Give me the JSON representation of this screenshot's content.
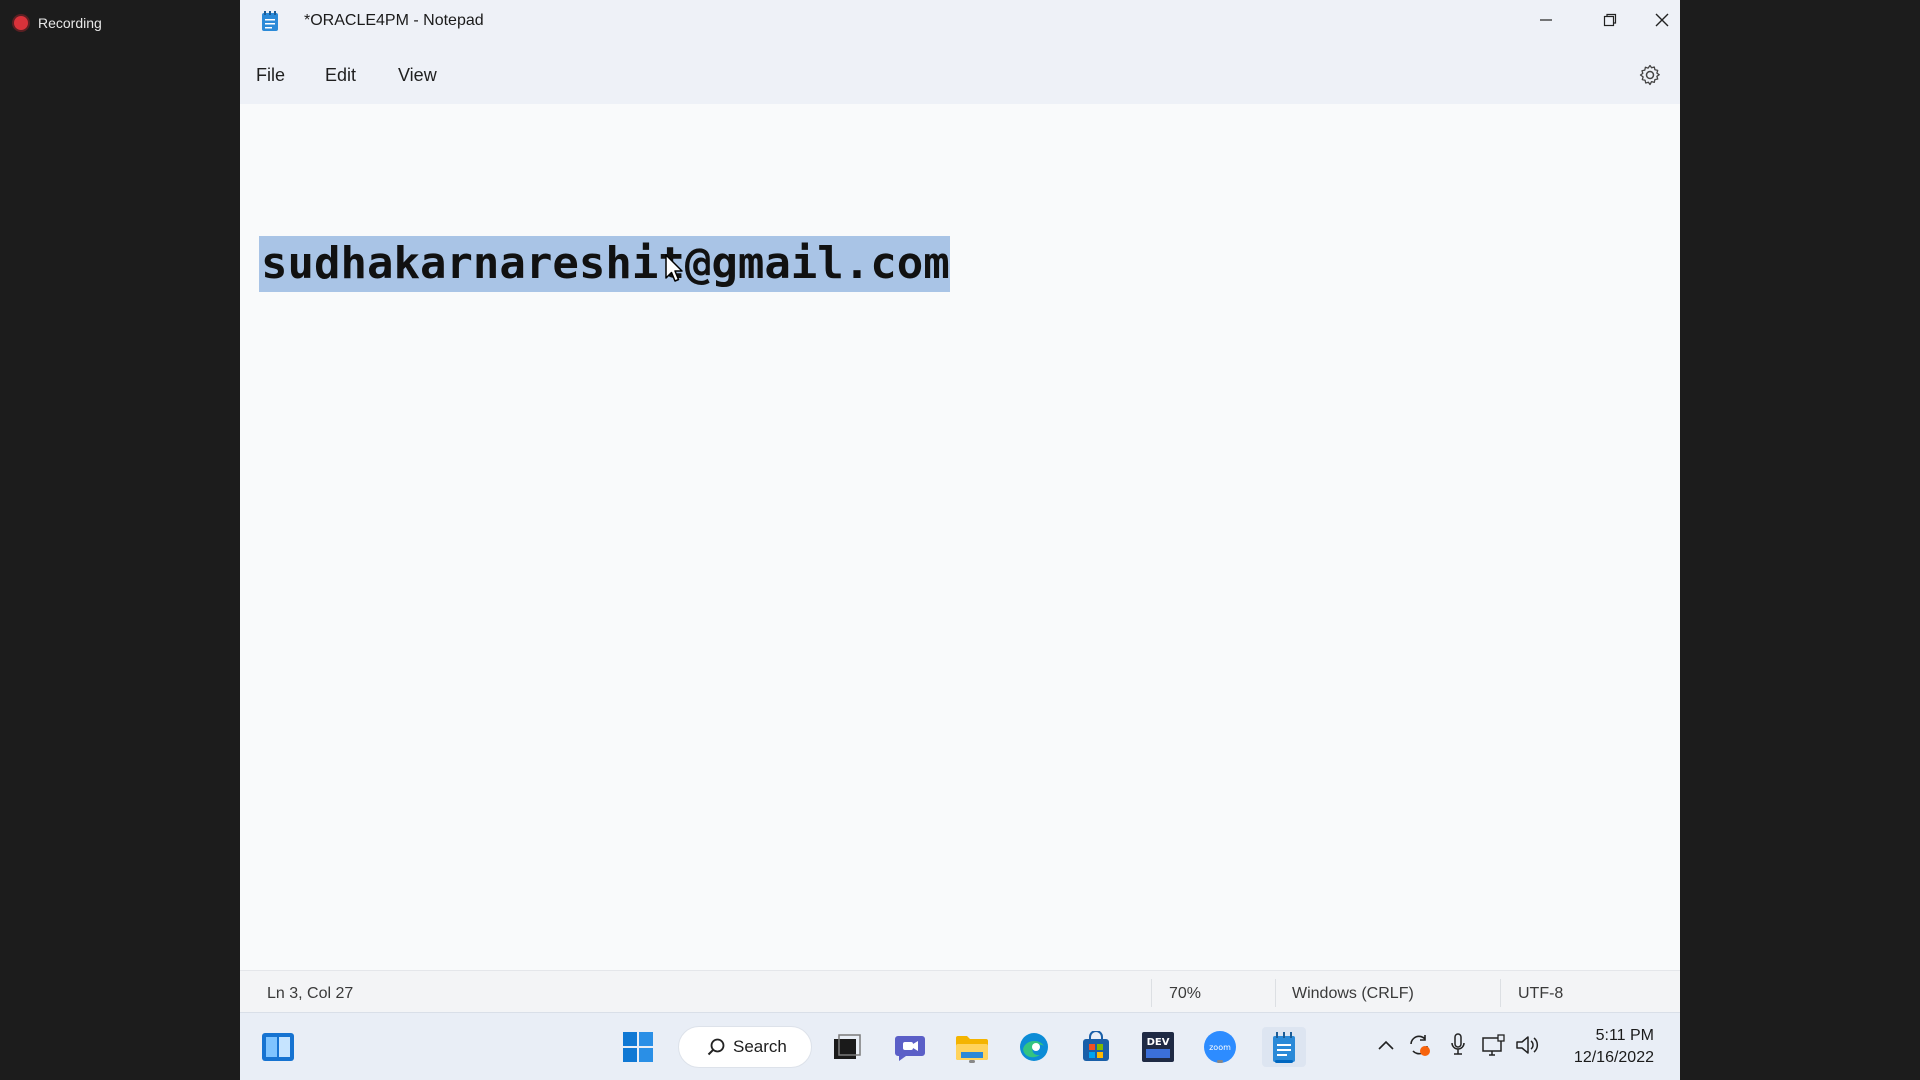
{
  "recording": {
    "label": "Recording"
  },
  "window": {
    "title": "*ORACLE4PM - Notepad",
    "controls": {
      "minimize": "–",
      "restore": "❐",
      "close": "✕"
    }
  },
  "menu": {
    "file": "File",
    "edit": "Edit",
    "view": "View"
  },
  "editor": {
    "selected_text": "sudhakarnareshit@gmail.com",
    "selection_color": "#a9c4e6"
  },
  "status": {
    "position": "Ln 3, Col 27",
    "zoom": "70%",
    "line_ending": "Windows (CRLF)",
    "encoding": "UTF-8"
  },
  "taskbar": {
    "search_label": "Search",
    "apps": [
      "start-icon",
      "search-icon",
      "task-view-icon",
      "teams-chat-icon",
      "file-explorer-icon",
      "edge-icon",
      "store-icon",
      "dev-icon",
      "zoom-icon",
      "notepad-icon"
    ],
    "clock": {
      "time": "5:11 PM",
      "date": "12/16/2022"
    },
    "accent": "#0067c0"
  }
}
